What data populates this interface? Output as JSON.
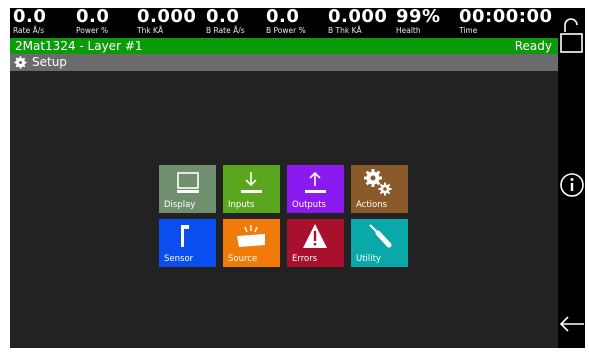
{
  "status": {
    "rate": {
      "value": "0.0",
      "label": "Rate Å/s"
    },
    "power": {
      "value": "0.0",
      "label": "Power %"
    },
    "thk": {
      "value": "0.000",
      "label": "Thk KÅ"
    },
    "b_rate": {
      "value": "0.0",
      "label": "B Rate Å/s"
    },
    "b_power": {
      "value": "0.0",
      "label": "B Power %"
    },
    "b_thk": {
      "value": "0.000",
      "label": "B Thk KÅ"
    },
    "health": {
      "value": "99%",
      "label": "Health"
    },
    "time": {
      "value": "00:00:00",
      "label": "Time"
    }
  },
  "titlebar": {
    "layer": "2Mat1324 - Layer #1",
    "state": "Ready"
  },
  "setup": {
    "label": "Setup"
  },
  "tiles": {
    "display": {
      "label": "Display",
      "color": "#6f8f6f"
    },
    "inputs": {
      "label": "Inputs",
      "color": "#5aa61e"
    },
    "outputs": {
      "label": "Outputs",
      "color": "#8a1aef"
    },
    "actions": {
      "label": "Actions",
      "color": "#8a5a2a"
    },
    "sensor": {
      "label": "Sensor",
      "color": "#0a4ef0"
    },
    "source": {
      "label": "Source",
      "color": "#f07a0a"
    },
    "errors": {
      "label": "Errors",
      "color": "#a8102e"
    },
    "utility": {
      "label": "Utility",
      "color": "#0aa8a8"
    }
  },
  "rail": {
    "icons": [
      "unlock-icon",
      "info-icon",
      "back-arrow-icon"
    ]
  }
}
